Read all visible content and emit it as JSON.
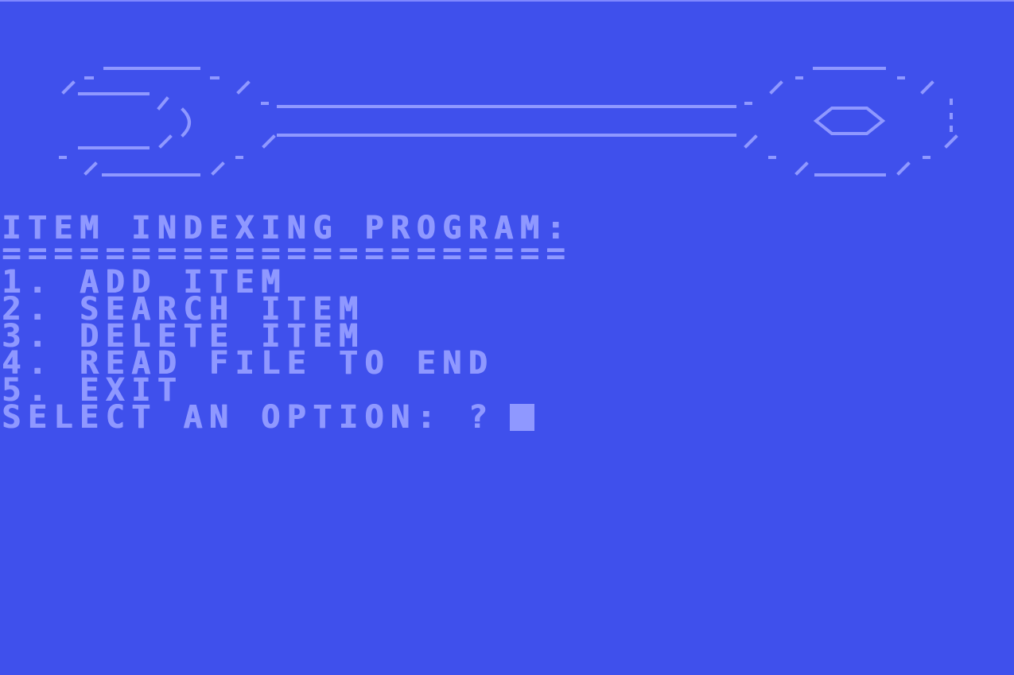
{
  "screen": {
    "background_color": "#3f50ec",
    "text_color": "#8f98ff",
    "header_art": "wrench-ascii-art"
  },
  "menu": {
    "title": "ITEM INDEXING PROGRAM:",
    "underline": "======================",
    "options": [
      "1. ADD ITEM",
      "2. SEARCH ITEM",
      "3. DELETE ITEM",
      "4. READ FILE TO END",
      "5. EXIT"
    ],
    "prompt": "SELECT AN OPTION: ?"
  }
}
